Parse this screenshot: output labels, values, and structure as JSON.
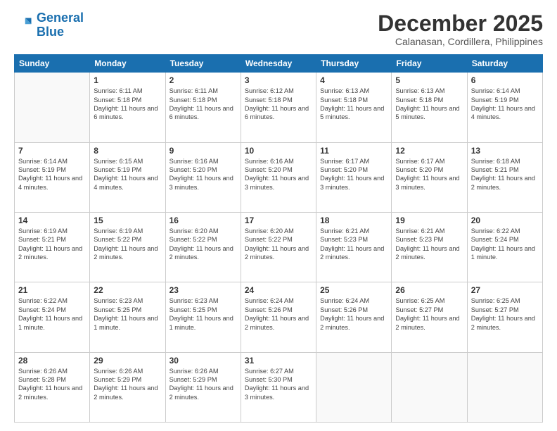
{
  "header": {
    "logo_line1": "General",
    "logo_line2": "Blue",
    "title": "December 2025",
    "subtitle": "Calanasan, Cordillera, Philippines"
  },
  "days_of_week": [
    "Sunday",
    "Monday",
    "Tuesday",
    "Wednesday",
    "Thursday",
    "Friday",
    "Saturday"
  ],
  "weeks": [
    [
      {
        "day": "",
        "sunrise": "",
        "sunset": "",
        "daylight": ""
      },
      {
        "day": "1",
        "sunrise": "Sunrise: 6:11 AM",
        "sunset": "Sunset: 5:18 PM",
        "daylight": "Daylight: 11 hours and 6 minutes."
      },
      {
        "day": "2",
        "sunrise": "Sunrise: 6:11 AM",
        "sunset": "Sunset: 5:18 PM",
        "daylight": "Daylight: 11 hours and 6 minutes."
      },
      {
        "day": "3",
        "sunrise": "Sunrise: 6:12 AM",
        "sunset": "Sunset: 5:18 PM",
        "daylight": "Daylight: 11 hours and 6 minutes."
      },
      {
        "day": "4",
        "sunrise": "Sunrise: 6:13 AM",
        "sunset": "Sunset: 5:18 PM",
        "daylight": "Daylight: 11 hours and 5 minutes."
      },
      {
        "day": "5",
        "sunrise": "Sunrise: 6:13 AM",
        "sunset": "Sunset: 5:18 PM",
        "daylight": "Daylight: 11 hours and 5 minutes."
      },
      {
        "day": "6",
        "sunrise": "Sunrise: 6:14 AM",
        "sunset": "Sunset: 5:19 PM",
        "daylight": "Daylight: 11 hours and 4 minutes."
      }
    ],
    [
      {
        "day": "7",
        "sunrise": "Sunrise: 6:14 AM",
        "sunset": "Sunset: 5:19 PM",
        "daylight": "Daylight: 11 hours and 4 minutes."
      },
      {
        "day": "8",
        "sunrise": "Sunrise: 6:15 AM",
        "sunset": "Sunset: 5:19 PM",
        "daylight": "Daylight: 11 hours and 4 minutes."
      },
      {
        "day": "9",
        "sunrise": "Sunrise: 6:16 AM",
        "sunset": "Sunset: 5:20 PM",
        "daylight": "Daylight: 11 hours and 3 minutes."
      },
      {
        "day": "10",
        "sunrise": "Sunrise: 6:16 AM",
        "sunset": "Sunset: 5:20 PM",
        "daylight": "Daylight: 11 hours and 3 minutes."
      },
      {
        "day": "11",
        "sunrise": "Sunrise: 6:17 AM",
        "sunset": "Sunset: 5:20 PM",
        "daylight": "Daylight: 11 hours and 3 minutes."
      },
      {
        "day": "12",
        "sunrise": "Sunrise: 6:17 AM",
        "sunset": "Sunset: 5:20 PM",
        "daylight": "Daylight: 11 hours and 3 minutes."
      },
      {
        "day": "13",
        "sunrise": "Sunrise: 6:18 AM",
        "sunset": "Sunset: 5:21 PM",
        "daylight": "Daylight: 11 hours and 2 minutes."
      }
    ],
    [
      {
        "day": "14",
        "sunrise": "Sunrise: 6:19 AM",
        "sunset": "Sunset: 5:21 PM",
        "daylight": "Daylight: 11 hours and 2 minutes."
      },
      {
        "day": "15",
        "sunrise": "Sunrise: 6:19 AM",
        "sunset": "Sunset: 5:22 PM",
        "daylight": "Daylight: 11 hours and 2 minutes."
      },
      {
        "day": "16",
        "sunrise": "Sunrise: 6:20 AM",
        "sunset": "Sunset: 5:22 PM",
        "daylight": "Daylight: 11 hours and 2 minutes."
      },
      {
        "day": "17",
        "sunrise": "Sunrise: 6:20 AM",
        "sunset": "Sunset: 5:22 PM",
        "daylight": "Daylight: 11 hours and 2 minutes."
      },
      {
        "day": "18",
        "sunrise": "Sunrise: 6:21 AM",
        "sunset": "Sunset: 5:23 PM",
        "daylight": "Daylight: 11 hours and 2 minutes."
      },
      {
        "day": "19",
        "sunrise": "Sunrise: 6:21 AM",
        "sunset": "Sunset: 5:23 PM",
        "daylight": "Daylight: 11 hours and 2 minutes."
      },
      {
        "day": "20",
        "sunrise": "Sunrise: 6:22 AM",
        "sunset": "Sunset: 5:24 PM",
        "daylight": "Daylight: 11 hours and 1 minute."
      }
    ],
    [
      {
        "day": "21",
        "sunrise": "Sunrise: 6:22 AM",
        "sunset": "Sunset: 5:24 PM",
        "daylight": "Daylight: 11 hours and 1 minute."
      },
      {
        "day": "22",
        "sunrise": "Sunrise: 6:23 AM",
        "sunset": "Sunset: 5:25 PM",
        "daylight": "Daylight: 11 hours and 1 minute."
      },
      {
        "day": "23",
        "sunrise": "Sunrise: 6:23 AM",
        "sunset": "Sunset: 5:25 PM",
        "daylight": "Daylight: 11 hours and 1 minute."
      },
      {
        "day": "24",
        "sunrise": "Sunrise: 6:24 AM",
        "sunset": "Sunset: 5:26 PM",
        "daylight": "Daylight: 11 hours and 2 minutes."
      },
      {
        "day": "25",
        "sunrise": "Sunrise: 6:24 AM",
        "sunset": "Sunset: 5:26 PM",
        "daylight": "Daylight: 11 hours and 2 minutes."
      },
      {
        "day": "26",
        "sunrise": "Sunrise: 6:25 AM",
        "sunset": "Sunset: 5:27 PM",
        "daylight": "Daylight: 11 hours and 2 minutes."
      },
      {
        "day": "27",
        "sunrise": "Sunrise: 6:25 AM",
        "sunset": "Sunset: 5:27 PM",
        "daylight": "Daylight: 11 hours and 2 minutes."
      }
    ],
    [
      {
        "day": "28",
        "sunrise": "Sunrise: 6:26 AM",
        "sunset": "Sunset: 5:28 PM",
        "daylight": "Daylight: 11 hours and 2 minutes."
      },
      {
        "day": "29",
        "sunrise": "Sunrise: 6:26 AM",
        "sunset": "Sunset: 5:29 PM",
        "daylight": "Daylight: 11 hours and 2 minutes."
      },
      {
        "day": "30",
        "sunrise": "Sunrise: 6:26 AM",
        "sunset": "Sunset: 5:29 PM",
        "daylight": "Daylight: 11 hours and 2 minutes."
      },
      {
        "day": "31",
        "sunrise": "Sunrise: 6:27 AM",
        "sunset": "Sunset: 5:30 PM",
        "daylight": "Daylight: 11 hours and 3 minutes."
      },
      {
        "day": "",
        "sunrise": "",
        "sunset": "",
        "daylight": ""
      },
      {
        "day": "",
        "sunrise": "",
        "sunset": "",
        "daylight": ""
      },
      {
        "day": "",
        "sunrise": "",
        "sunset": "",
        "daylight": ""
      }
    ]
  ]
}
